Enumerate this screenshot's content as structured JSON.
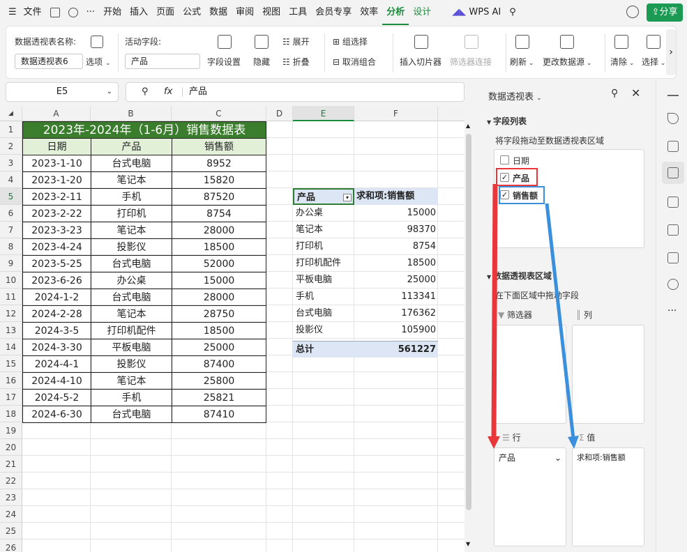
{
  "menu": {
    "file": "文件",
    "tabs": [
      "开始",
      "插入",
      "页面",
      "公式",
      "数据",
      "审阅",
      "视图",
      "工具",
      "会员专享",
      "效率",
      "分析",
      "设计"
    ],
    "active_tab": "分析",
    "wps_ai": "WPS AI",
    "share": "分享"
  },
  "ribbon": {
    "pt_name_label": "数据透视表名称:",
    "pt_name_value": "数据透视表6",
    "options": "选项",
    "active_field_label": "活动字段:",
    "active_field_value": "产品",
    "field_settings": "字段设置",
    "hide": "隐藏",
    "expand": "展开",
    "collapse": "折叠",
    "group_select": "组选择",
    "ungroup": "取消组合",
    "insert_slicer": "插入切片器",
    "filter_connect": "筛选器连接",
    "refresh": "刷新",
    "change_source": "更改数据源",
    "clear": "清除",
    "select": "选择"
  },
  "formula_bar": {
    "name_box": "E5",
    "fx": "fx",
    "content": "产品"
  },
  "columns": [
    "A",
    "B",
    "C",
    "D",
    "E",
    "F"
  ],
  "rows": [
    "1",
    "2",
    "3",
    "4",
    "5",
    "6",
    "7",
    "8",
    "9",
    "10",
    "11",
    "12",
    "13",
    "14",
    "15",
    "16",
    "17",
    "18",
    "19",
    "20",
    "21",
    "22",
    "23",
    "24",
    "25",
    "26"
  ],
  "table": {
    "title": "2023年-2024年（1-6月）销售数据表",
    "headers": [
      "日期",
      "产品",
      "销售额"
    ],
    "rows": [
      [
        "2023-1-10",
        "台式电脑",
        "8952"
      ],
      [
        "2023-1-20",
        "笔记本",
        "15820"
      ],
      [
        "2023-2-11",
        "手机",
        "87520"
      ],
      [
        "2023-2-22",
        "打印机",
        "8754"
      ],
      [
        "2023-3-23",
        "笔记本",
        "28000"
      ],
      [
        "2023-4-24",
        "投影仪",
        "18500"
      ],
      [
        "2023-5-25",
        "台式电脑",
        "52000"
      ],
      [
        "2023-6-26",
        "办公桌",
        "15000"
      ],
      [
        "2024-1-2",
        "台式电脑",
        "28000"
      ],
      [
        "2024-2-28",
        "笔记本",
        "28750"
      ],
      [
        "2024-3-5",
        "打印机配件",
        "18500"
      ],
      [
        "2024-3-30",
        "平板电脑",
        "25000"
      ],
      [
        "2024-4-1",
        "投影仪",
        "87400"
      ],
      [
        "2024-4-10",
        "笔记本",
        "25800"
      ],
      [
        "2024-5-2",
        "手机",
        "25821"
      ],
      [
        "2024-6-30",
        "台式电脑",
        "87410"
      ]
    ]
  },
  "pivot": {
    "header_left": "产品",
    "header_right": "求和项:销售额",
    "rows": [
      [
        "办公桌",
        "15000"
      ],
      [
        "笔记本",
        "98370"
      ],
      [
        "打印机",
        "8754"
      ],
      [
        "打印机配件",
        "18500"
      ],
      [
        "平板电脑",
        "25000"
      ],
      [
        "手机",
        "113341"
      ],
      [
        "台式电脑",
        "176362"
      ],
      [
        "投影仪",
        "105900"
      ]
    ],
    "total_label": "总计",
    "total_value": "561227"
  },
  "panel": {
    "title": "数据透视表",
    "field_list": "字段列表",
    "drag_hint": "将字段拖动至数据透视表区域",
    "fields": [
      {
        "label": "日期",
        "checked": false
      },
      {
        "label": "产品",
        "checked": true
      },
      {
        "label": "销售额",
        "checked": true
      }
    ],
    "areas_title": "数据透视表区域",
    "areas_hint": "在下面区域中拖动字段",
    "filter_label": "筛选器",
    "column_label": "列",
    "row_label": "行",
    "value_label": "值",
    "row_field": "产品",
    "value_field": "求和项:销售额"
  },
  "colors": {
    "accent": "#1a8b3c",
    "title_bg": "#3a7d2c",
    "header_bg": "#e3f0d8",
    "pivot_header_bg": "#dce6f4",
    "red_arrow": "#e8363a",
    "blue_arrow": "#3a90dc"
  }
}
